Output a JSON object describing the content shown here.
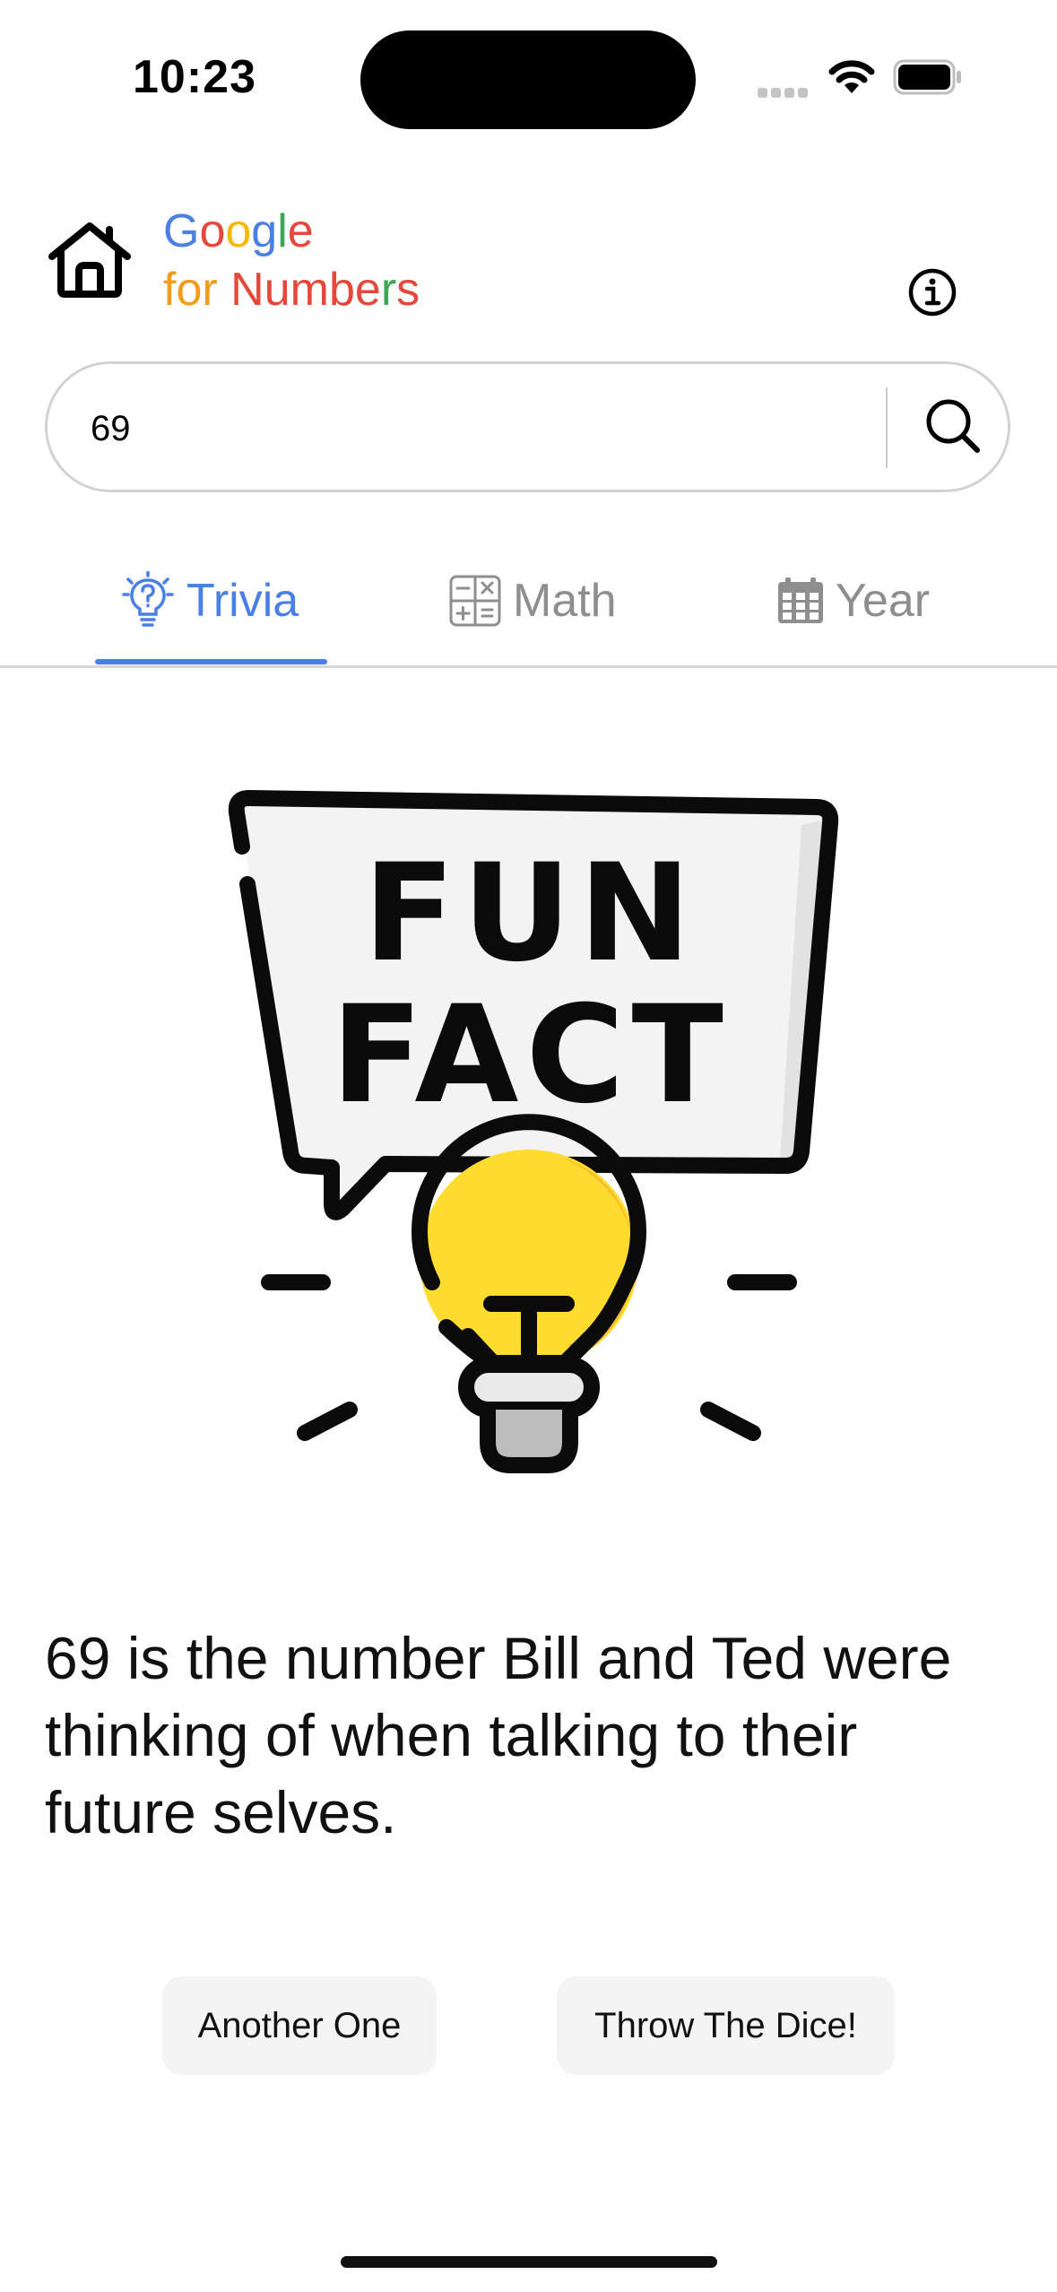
{
  "status_bar": {
    "time": "10:23",
    "icons": [
      "cellular-signal-icon",
      "wifi-icon",
      "battery-icon"
    ]
  },
  "header": {
    "brand_line1": [
      {
        "char": "G",
        "color": "#4a7fe4"
      },
      {
        "char": "o",
        "color": "#e5473b"
      },
      {
        "char": "o",
        "color": "#f6b70f"
      },
      {
        "char": "g",
        "color": "#4a7fe4"
      },
      {
        "char": "l",
        "color": "#3aa757"
      },
      {
        "char": "e",
        "color": "#e5473b"
      }
    ],
    "brand_line2": [
      {
        "char": "f",
        "color": "#f39b1a"
      },
      {
        "char": "o",
        "color": "#f39b1a"
      },
      {
        "char": "r",
        "color": "#f39b1a"
      },
      {
        "char": " ",
        "color": "#f39b1a"
      },
      {
        "char": "N",
        "color": "#e5473b"
      },
      {
        "char": "u",
        "color": "#e5473b"
      },
      {
        "char": "m",
        "color": "#e5473b"
      },
      {
        "char": "b",
        "color": "#e5473b"
      },
      {
        "char": "e",
        "color": "#e5473b"
      },
      {
        "char": "r",
        "color": "#3aa757"
      },
      {
        "char": "s",
        "color": "#e5473b"
      }
    ],
    "icons": [
      "home-icon",
      "info-icon"
    ]
  },
  "search": {
    "value": "69",
    "icon": "search-icon"
  },
  "tabs": [
    {
      "label": "Trivia",
      "icon": "lightbulb-question-icon",
      "active": true
    },
    {
      "label": "Math",
      "icon": "calculator-icon",
      "active": false
    },
    {
      "label": "Year",
      "icon": "calendar-icon",
      "active": false
    }
  ],
  "illustration": {
    "line1": "FUN",
    "line2": "FACT",
    "icon": "fun-fact-lightbulb-icon"
  },
  "fact": {
    "text": "69 is the number Bill and Ted were thinking of when talking to their future selves."
  },
  "actions": {
    "another_label": "Another One",
    "dice_label": "Throw The Dice!"
  },
  "colors": {
    "accent": "#4a7fe4",
    "inactive_tab": "#8e8e8e",
    "bulb_yellow": "#ffdc2f",
    "bulb_shade": "#f7b52c"
  }
}
